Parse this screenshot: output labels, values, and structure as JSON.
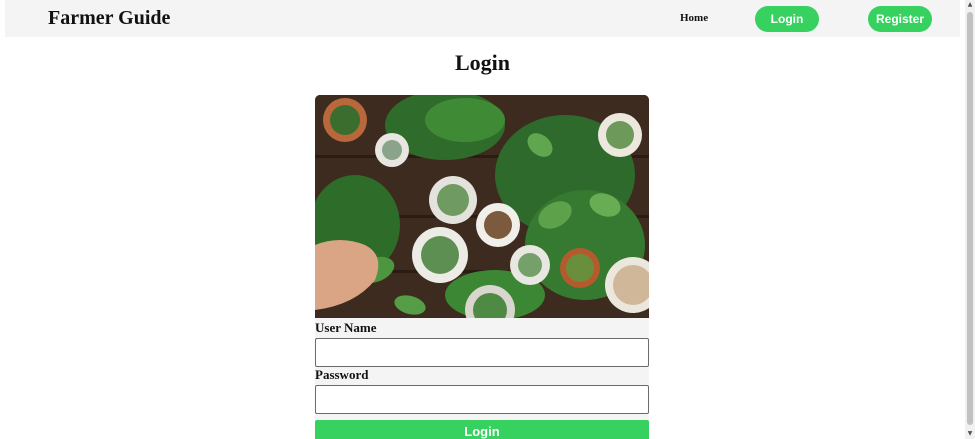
{
  "navbar": {
    "brand": "Farmer Guide",
    "home_label": "Home",
    "login_label": "Login",
    "register_label": "Register"
  },
  "page": {
    "title": "Login"
  },
  "form": {
    "image_alt": "Top view of assorted potted houseplants on a wooden table",
    "username_label": "User Name",
    "username_value": "",
    "password_label": "Password",
    "password_value": "",
    "submit_label": "Login"
  },
  "colors": {
    "accent_green": "#36d15f",
    "navbar_bg": "#f4f4f4"
  },
  "icons": {
    "scroll_up": "▲",
    "scroll_down": "▼"
  }
}
